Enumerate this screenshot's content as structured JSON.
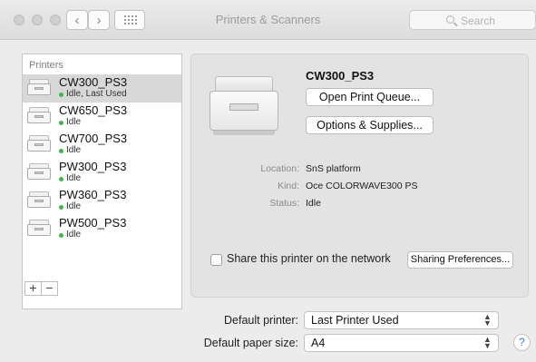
{
  "window": {
    "title": "Printers & Scanners"
  },
  "toolbar": {
    "back": "‹",
    "forward": "›",
    "search_placeholder": "Search"
  },
  "printers_list": {
    "header": "Printers",
    "items": [
      {
        "name": "CW300_PS3",
        "status": "Idle, Last Used",
        "selected": true
      },
      {
        "name": "CW650_PS3",
        "status": "Idle"
      },
      {
        "name": "CW700_PS3",
        "status": "Idle"
      },
      {
        "name": "PW300_PS3",
        "status": "Idle"
      },
      {
        "name": "PW360_PS3",
        "status": "Idle"
      },
      {
        "name": "PW500_PS3",
        "status": "Idle"
      }
    ],
    "add_label": "+",
    "remove_label": "−"
  },
  "detail": {
    "printer_name": "CW300_PS3",
    "open_queue_label": "Open Print Queue...",
    "options_label": "Options & Supplies...",
    "location_label": "Location:",
    "location_value": "SnS platform",
    "kind_label": "Kind:",
    "kind_value": "Oce COLORWAVE300 PS",
    "status_label": "Status:",
    "status_value": "Idle",
    "share_label": "Share this printer on the network",
    "share_checked": false,
    "sharing_prefs_label": "Sharing Preferences..."
  },
  "defaults": {
    "printer_label": "Default printer:",
    "printer_value": "Last Printer Used",
    "paper_label": "Default paper size:",
    "paper_value": "A4"
  },
  "help_label": "?",
  "colors": {
    "status_idle": "#3fb648",
    "help_accent": "#3478f6"
  }
}
